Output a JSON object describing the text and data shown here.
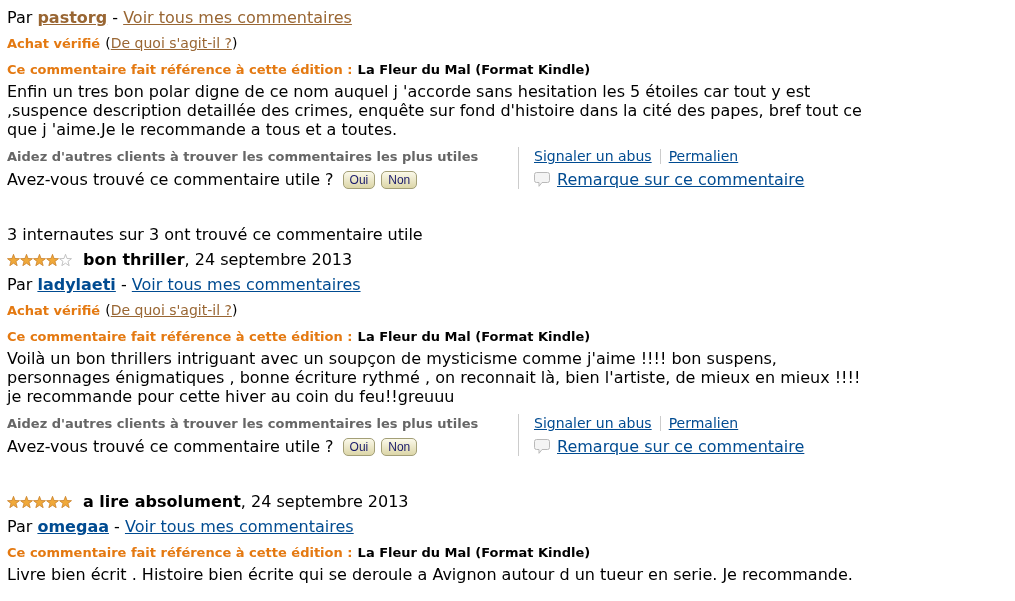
{
  "reviews": [
    {
      "byline": {
        "prefix": "Par",
        "author": {
          "name": "pastorg",
          "visited": true
        },
        "separator": "-",
        "all_reviews": {
          "label": "Voir tous mes commentaires",
          "visited": true
        }
      },
      "verified": {
        "label": "Achat vérifié",
        "open": "(",
        "help_link": {
          "label": "De quoi s'agit-il ?",
          "visited": true
        },
        "close": ")"
      },
      "edition": {
        "label": "Ce commentaire fait référence à cette édition :",
        "title": "La Fleur du Mal (Format Kindle)"
      },
      "body": "Enfin un tres bon polar digne de ce nom auquel j 'accorde sans hesitation les 5 étoiles car tout y est\n,suspence description detaillée des crimes, enquête sur fond d'histoire dans la cité des papes, bref tout ce\nque j 'aime.Je le recommande a tous et a toutes.",
      "feedback": {
        "prompt": "Aidez d'autres clients à trouver les commentaires les plus utiles",
        "question": "Avez-vous trouvé ce commentaire utile ?",
        "buttons": [
          "Oui",
          "Non"
        ],
        "links": [
          "Signaler un abus",
          "Permalien"
        ],
        "remark_link": "Remarque sur ce commentaire"
      }
    },
    {
      "helpful_count": "3 internautes sur 3 ont trouvé ce commentaire utile",
      "stars": 4,
      "headline": "**bon thriller**, 24 septembre 2013",
      "byline": {
        "prefix": "Par",
        "author": {
          "name": "ladylaeti",
          "visited": false
        },
        "separator": "-",
        "all_reviews": {
          "label": "Voir tous mes commentaires",
          "visited": false
        }
      },
      "verified": {
        "label": "Achat vérifié",
        "open": "(",
        "help_link": {
          "label": "De quoi s'agit-il ?",
          "visited": true
        },
        "close": ")"
      },
      "edition": {
        "label": "Ce commentaire fait référence à cette édition :",
        "title": "La Fleur du Mal (Format Kindle)"
      },
      "body": "Voilà un bon thrillers intriguant avec un soupçon de mysticisme comme j'aime !!!! bon suspens,\npersonnages énigmatiques , bonne écriture rythmé , on reconnait là, bien l'artiste, de mieux en mieux !!!!\nje recommande pour cette hiver au coin du feu!!greuuu",
      "feedback": {
        "prompt": "Aidez d'autres clients à trouver les commentaires les plus utiles",
        "question": "Avez-vous trouvé ce commentaire utile ?",
        "buttons": [
          "Oui",
          "Non"
        ],
        "links": [
          "Signaler un abus",
          "Permalien"
        ],
        "remark_link": "Remarque sur ce commentaire"
      }
    },
    {
      "stars": 5,
      "headline": "**a lire absolument**, 24 septembre 2013",
      "byline": {
        "prefix": "Par",
        "author": {
          "name": "omegaa",
          "visited": false
        },
        "separator": "-",
        "all_reviews": {
          "label": "Voir tous mes commentaires",
          "visited": false
        }
      },
      "edition": {
        "label": "Ce commentaire fait référence à cette édition :",
        "title": "La Fleur du Mal (Format Kindle)"
      },
      "body": "Livre bien écrit . Histoire bien écrite qui se deroule a Avignon autour d un tueur en serie. Je recommande."
    }
  ]
}
